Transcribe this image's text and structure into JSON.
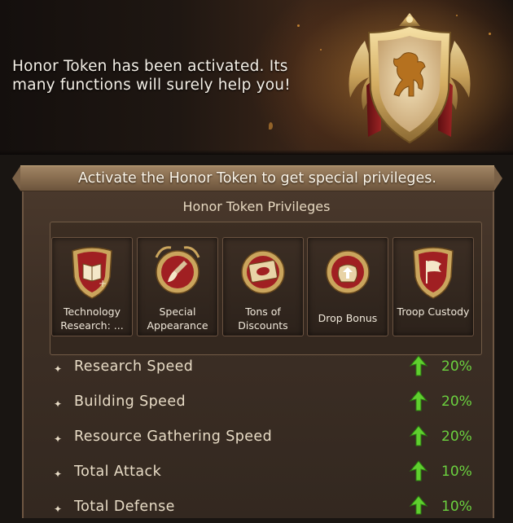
{
  "banner": {
    "message": "Honor Token has been activated. Its many functions will surely help you!"
  },
  "panel": {
    "ribbon_text": "Activate the Honor Token to get special privileges.",
    "privileges_title": "Honor Token Privileges"
  },
  "privileges": [
    {
      "label": "Technology Research: ...",
      "icon": "book-shield-icon"
    },
    {
      "label": "Special Appearance",
      "icon": "brush-icon"
    },
    {
      "label": "Tons of Discounts",
      "icon": "discount-ticket-icon"
    },
    {
      "label": "Drop Bonus",
      "icon": "loot-bag-up-icon"
    },
    {
      "label": "Troop Custody",
      "icon": "flag-shield-icon"
    }
  ],
  "stats": [
    {
      "name": "Research Speed",
      "value": "20%"
    },
    {
      "name": "Building Speed",
      "value": "20%"
    },
    {
      "name": "Resource Gathering Speed",
      "value": "20%"
    },
    {
      "name": "Total Attack",
      "value": "10%"
    },
    {
      "name": "Total Defense",
      "value": "10%"
    }
  ],
  "colors": {
    "stat_value": "#6bd13f",
    "gold": "#d9b76a",
    "emblem_red": "#8e1b1b"
  }
}
